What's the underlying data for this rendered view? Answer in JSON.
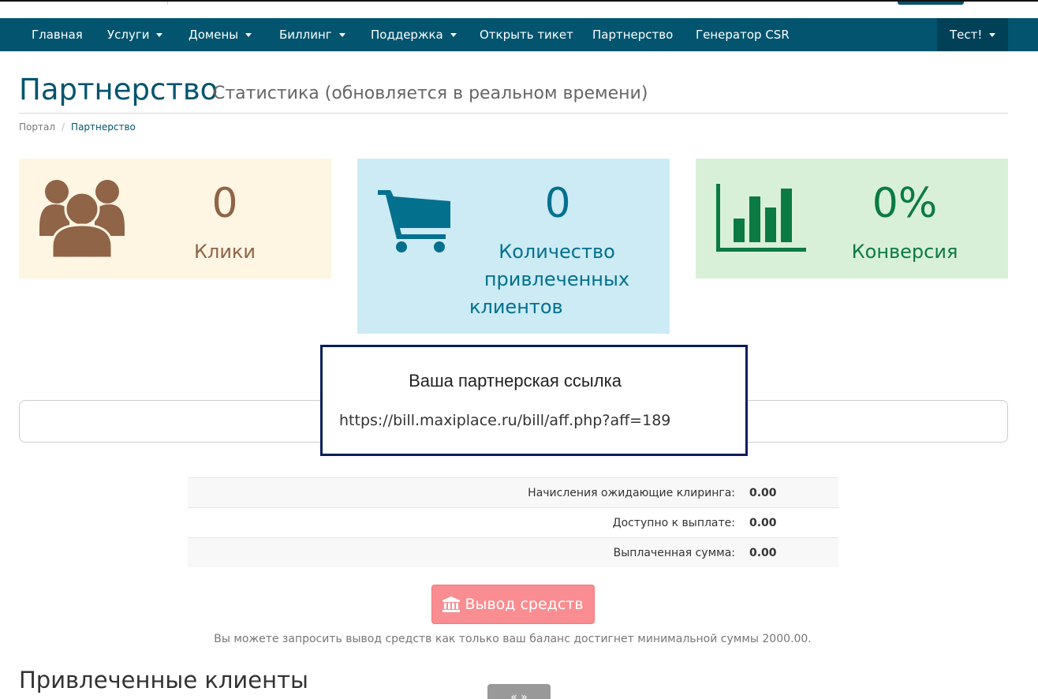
{
  "nav": {
    "items": [
      {
        "label": "Главная",
        "dropdown": false
      },
      {
        "label": "Услуги",
        "dropdown": true
      },
      {
        "label": "Домены",
        "dropdown": true
      },
      {
        "label": "Биллинг",
        "dropdown": true
      },
      {
        "label": "Поддержка",
        "dropdown": true
      },
      {
        "label": "Открыть тикет",
        "dropdown": false
      },
      {
        "label": "Партнерство",
        "dropdown": false
      },
      {
        "label": "Генератор CSR",
        "dropdown": false
      }
    ],
    "user": "Тест!"
  },
  "page": {
    "title": "Партнерство",
    "subtitle": "Статистика (обновляется в реальном времени)"
  },
  "breadcrumb": {
    "home": "Портал",
    "current": "Партнерство"
  },
  "stats": {
    "clicks": {
      "value": "0",
      "label": "Клики",
      "icon": "users-icon"
    },
    "clients": {
      "value": "0",
      "label_lines": [
        "Количество",
        "привлеченных",
        "клиентов"
      ],
      "icon": "cart-icon"
    },
    "conversion": {
      "value": "0%",
      "label": "Конверсия",
      "icon": "bar-chart-icon"
    }
  },
  "affiliate": {
    "title": "Ваша партнерская ссылка",
    "url": "https://bill.maxiplace.ru/bill/aff.php?aff=189"
  },
  "balances": [
    {
      "label": "Начисления ожидающие клиринга:",
      "value": "0.00"
    },
    {
      "label": "Доступно к выплате:",
      "value": "0.00"
    },
    {
      "label": "Выплаченная сумма:",
      "value": "0.00"
    }
  ],
  "withdraw": {
    "button_label": "Вывод средств",
    "icon": "bank-icon",
    "note": "Вы можете запросить вывод средств как только ваш баланс достигнет минимальной суммы 2000.00."
  },
  "referrals": {
    "title": "Привлеченные клиенты",
    "pager_label": "« »"
  },
  "colors": {
    "navbar": "#02546f",
    "navbar_active": "#014158",
    "clicks_bg": "#fef5e3",
    "clicks_fg": "#8f6447",
    "clients_bg": "#ccebf5",
    "clients_fg": "#03708e",
    "conversion_bg": "#d9f0d8",
    "conversion_fg": "#0c7a43",
    "withdraw_btn": "#f98d91"
  }
}
